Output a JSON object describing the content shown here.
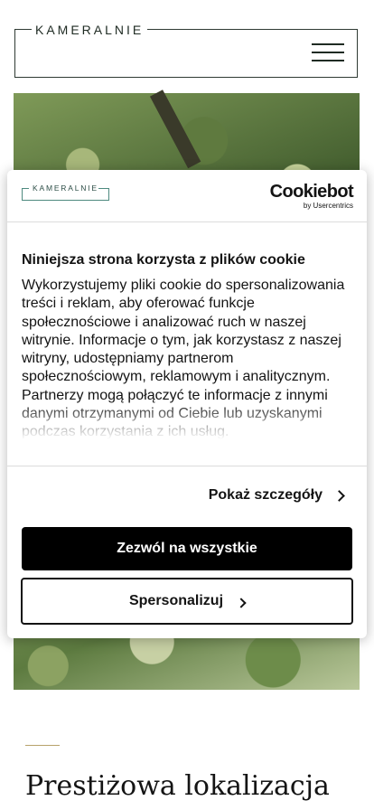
{
  "header": {
    "logo_text": "KAMERALNIE",
    "menu_icon": "hamburger-menu-icon"
  },
  "section": {
    "title": "Prestiżowa lokalizacja"
  },
  "cookie_dialog": {
    "logo_text": "KAMERALNIE",
    "brand": "Cookiebot",
    "brand_sub": "by Usercentrics",
    "title": "Niniejsza strona korzysta z plików cookie",
    "text": "Wykorzystujemy pliki cookie do spersonalizowania treści i reklam, aby oferować funkcje społecznościowe i analizować ruch w naszej witrynie. Informacje o tym, jak korzystasz z naszej witryny, udostępniamy partnerom społecznościowym, reklamowym i analitycznym. Partnerzy mogą połączyć te informacje z innymi danymi otrzymanymi od Ciebie lub uzyskanymi podczas korzystania z ich usług.",
    "details_label": "Pokaż szczegóły",
    "allow_all_label": "Zezwól na wszystkie",
    "customize_label": "Spersonalizuj",
    "colors": {
      "allow_bg": "#000000",
      "logo_accent": "#4e8a7f"
    }
  }
}
